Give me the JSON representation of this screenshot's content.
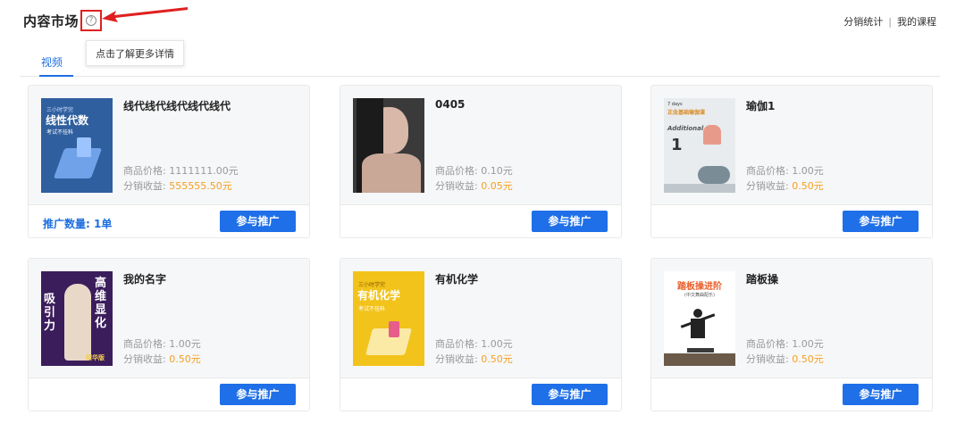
{
  "header": {
    "title": "内容市场",
    "help_icon": "question-circle-icon",
    "tooltip": "点击了解更多详情",
    "links": [
      "分销统计",
      "我的课程"
    ],
    "accent_color": "#e02020"
  },
  "tabs": [
    {
      "label": "视频",
      "active": true
    }
  ],
  "colors": {
    "primary": "#1f6fe8",
    "income": "#f5a020"
  },
  "products": [
    {
      "title": "线代线代线代线代线代",
      "price_label": "商品价格: ",
      "price": "1111111.00元",
      "income_label": "分销收益: ",
      "income": "555555.50元",
      "promo_count": "推广数量: 1单",
      "button": "参与推广",
      "thumb": {
        "line1": "三小时学完",
        "line2": "线性代数",
        "line3": "考试不挂科"
      }
    },
    {
      "title": "0405",
      "price_label": "商品价格: ",
      "price": "0.10元",
      "income_label": "分销收益: ",
      "income": "0.05元",
      "button": "参与推广"
    },
    {
      "title": "瑜伽1",
      "price_label": "商品价格: ",
      "price": "1.00元",
      "income_label": "分销收益: ",
      "income": "0.50元",
      "button": "参与推广",
      "thumb": {
        "line1": "7 days",
        "line2": "正念基础瑜伽课",
        "line3": "Additional",
        "line4": "1"
      }
    },
    {
      "title": "我的名字",
      "price_label": "商品价格: ",
      "price": "1.00元",
      "income_label": "分销收益: ",
      "income": "0.50元",
      "button": "参与推广",
      "thumb": {
        "line1": "吸引力",
        "line2": "高维显化",
        "line3": "精华版"
      }
    },
    {
      "title": "有机化学",
      "price_label": "商品价格: ",
      "price": "1.00元",
      "income_label": "分销收益: ",
      "income": "0.50元",
      "button": "参与推广",
      "thumb": {
        "line1": "三小时学完",
        "line2": "有机化学",
        "line3": "考试不挂科"
      }
    },
    {
      "title": "踏板操",
      "price_label": "商品价格: ",
      "price": "1.00元",
      "income_label": "分销收益: ",
      "income": "0.50元",
      "button": "参与推广",
      "thumb": {
        "line1": "踏板操进阶",
        "line2": "(中文舞曲配乐)"
      }
    }
  ]
}
